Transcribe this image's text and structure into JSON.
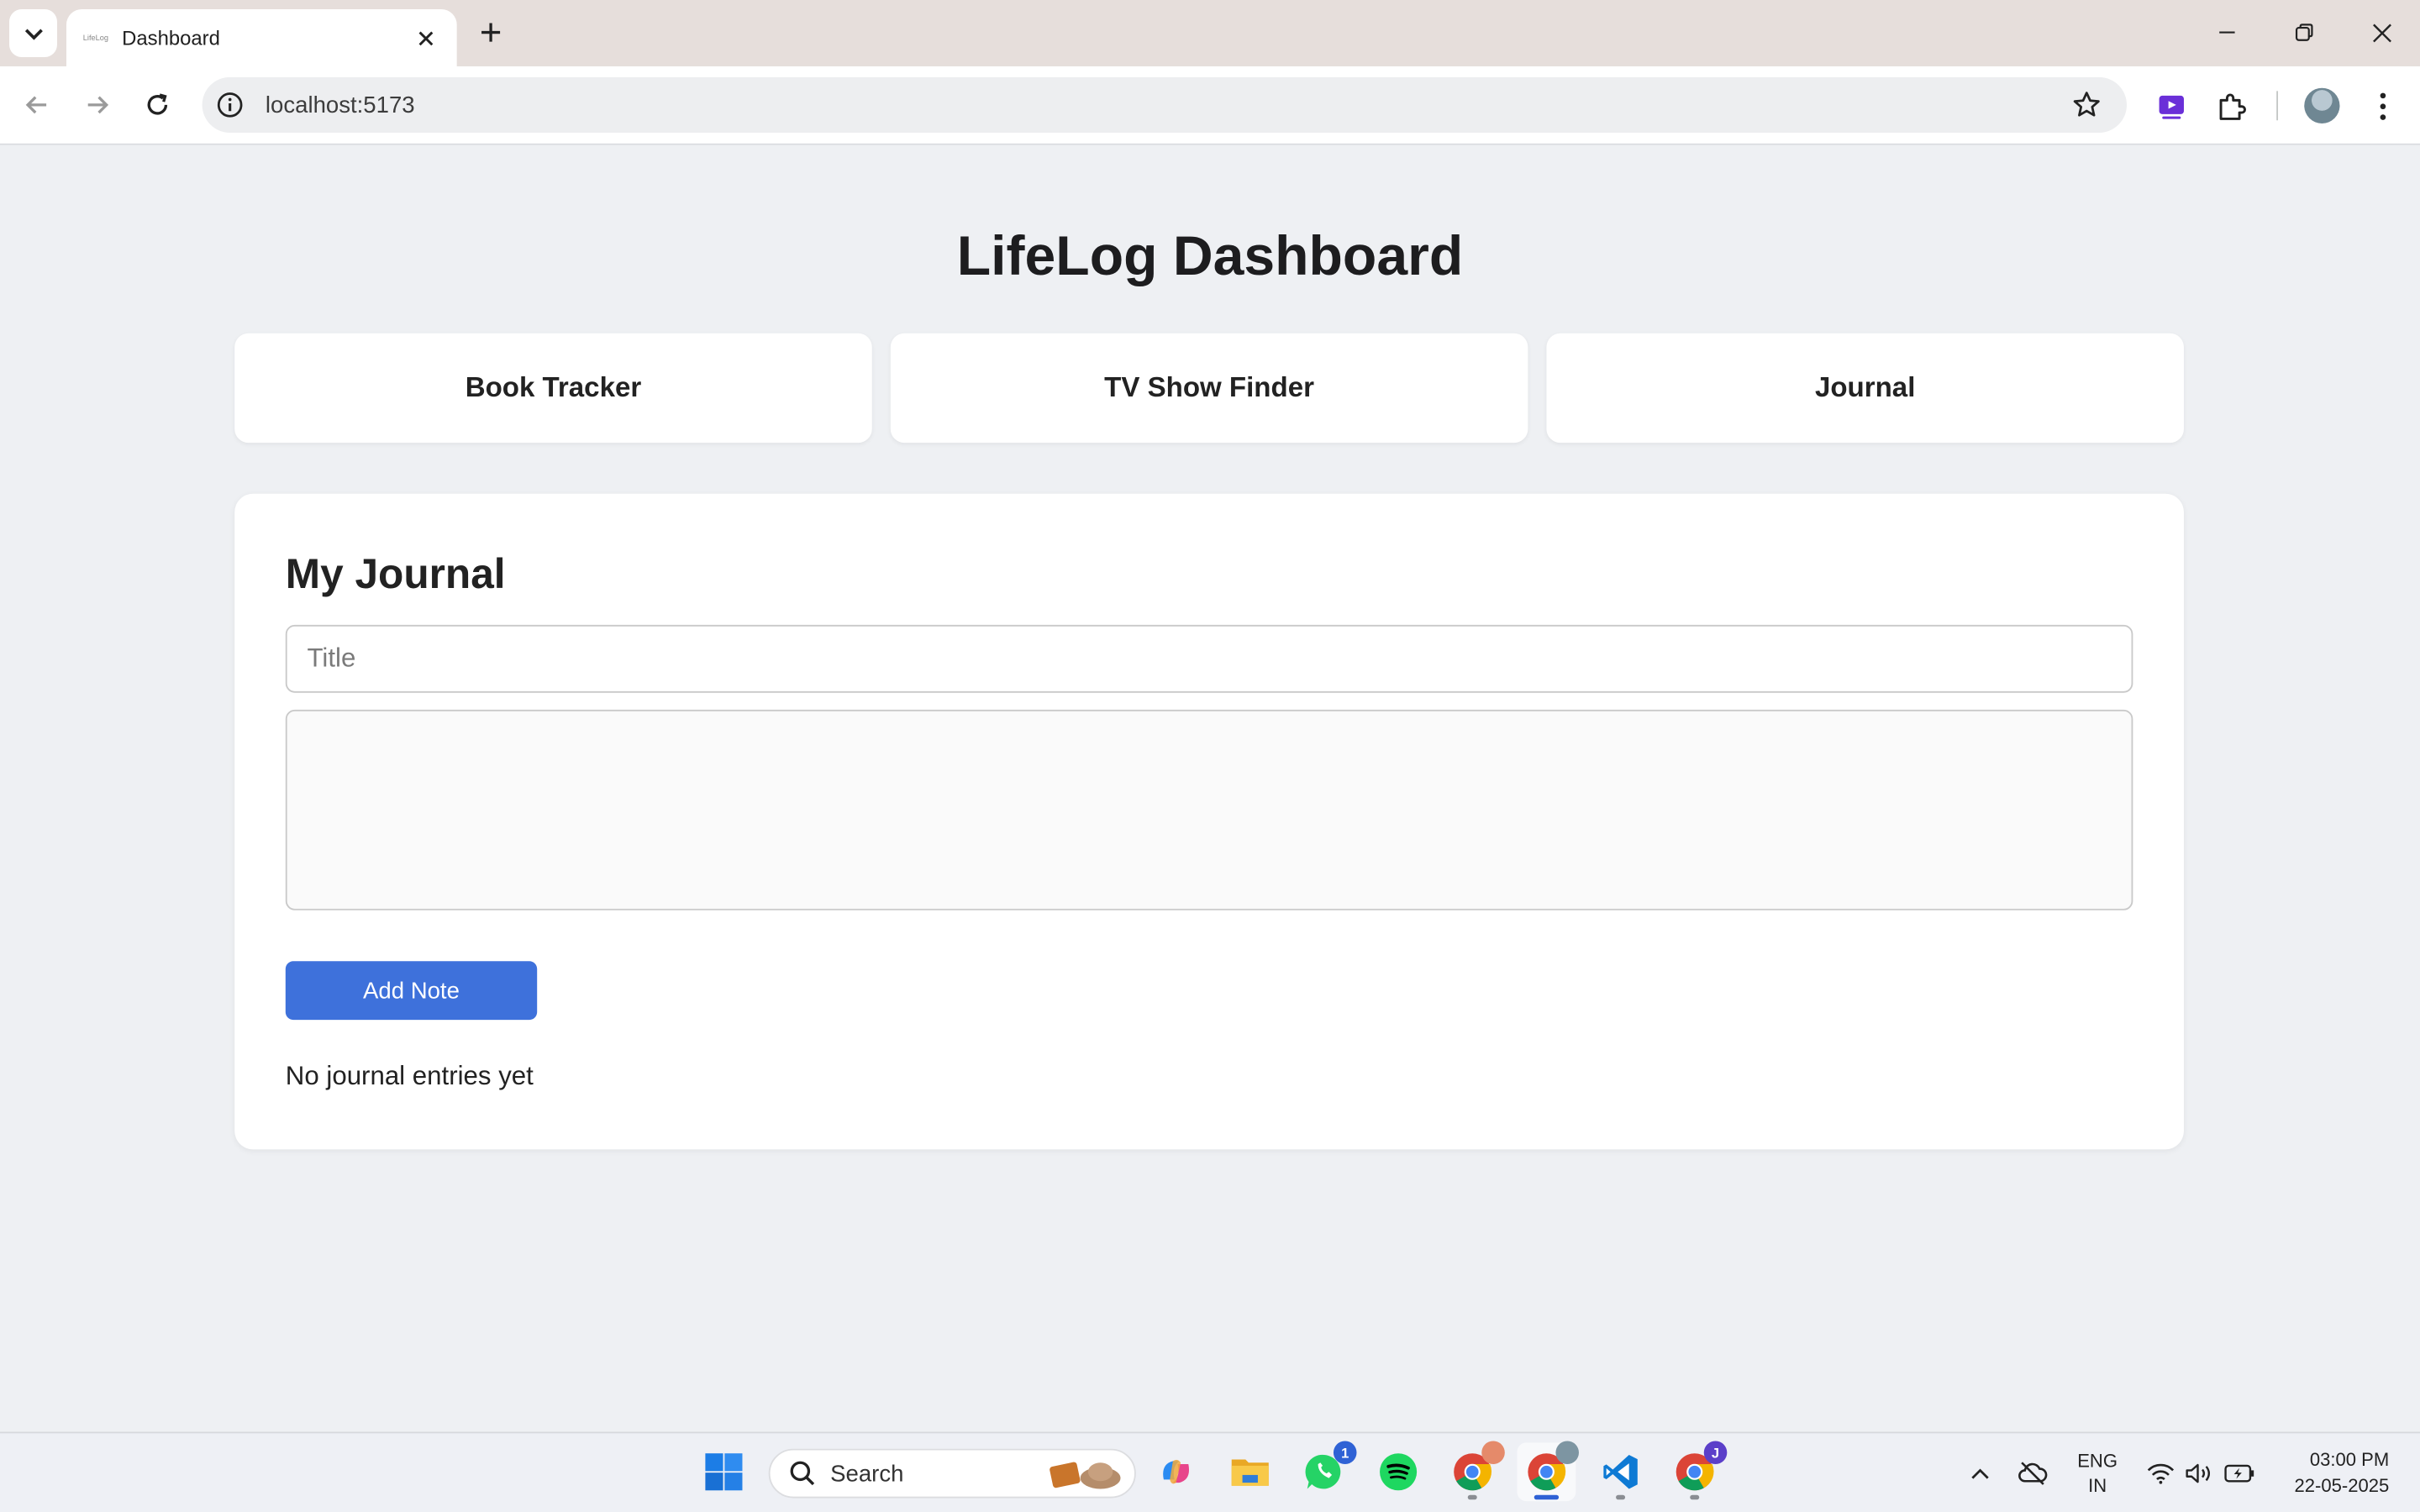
{
  "browser": {
    "tab_title": "Dashboard",
    "favicon_text": "LifeLog",
    "url": "localhost:5173"
  },
  "page": {
    "title": "LifeLog Dashboard",
    "nav_cards": [
      "Book Tracker",
      "TV Show Finder",
      "Journal"
    ],
    "journal": {
      "heading": "My Journal",
      "title_placeholder": "Title",
      "title_value": "",
      "body_value": "",
      "add_button": "Add Note",
      "empty_message": "No journal entries yet"
    }
  },
  "taskbar": {
    "search_label": "Search",
    "whatsapp_badge": "1",
    "chrome_profile_badge": "J",
    "language": "ENG",
    "region": "IN",
    "time": "03:00 PM",
    "date": "22-05-2025"
  },
  "colors": {
    "accent": "#3e71db",
    "page_bg": "#eef0f3",
    "card_bg": "#ffffff"
  }
}
